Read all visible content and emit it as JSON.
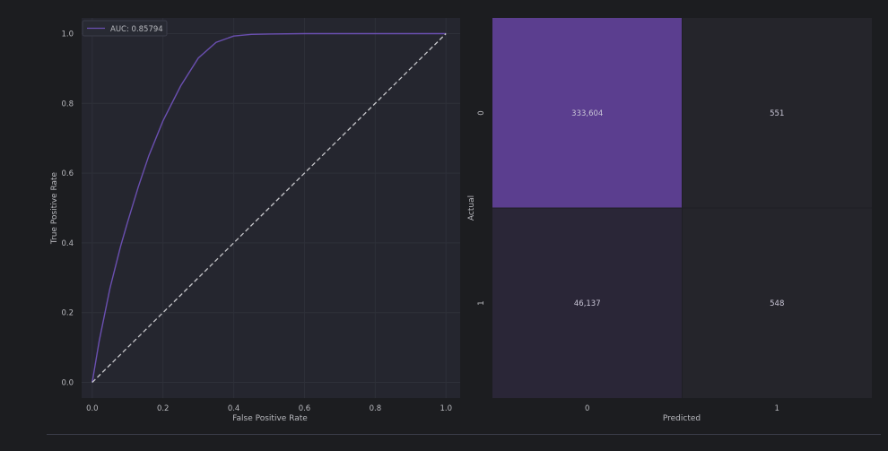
{
  "chart_data": [
    {
      "type": "line",
      "title": "",
      "xlabel": "False Positive Rate",
      "ylabel": "True Positive Rate",
      "xlim": [
        -0.03,
        1.04
      ],
      "ylim": [
        -0.045,
        1.045
      ],
      "xticks": [
        "0.0",
        "0.2",
        "0.4",
        "0.6",
        "0.8",
        "1.0"
      ],
      "yticks": [
        "0.0",
        "0.2",
        "0.4",
        "0.6",
        "0.8",
        "1.0"
      ],
      "grid": true,
      "legend": {
        "position": "top-left",
        "entries": [
          "AUC: 0.85794"
        ]
      },
      "series": [
        {
          "name": "AUC: 0.85794",
          "color": "#6a4fb0",
          "style": "solid",
          "x": [
            0.0,
            0.02,
            0.05,
            0.08,
            0.1,
            0.13,
            0.16,
            0.2,
            0.25,
            0.3,
            0.35,
            0.4,
            0.45,
            0.5,
            0.6,
            0.7,
            0.8,
            0.9,
            1.0
          ],
          "y": [
            0.0,
            0.12,
            0.27,
            0.39,
            0.46,
            0.56,
            0.65,
            0.75,
            0.85,
            0.93,
            0.975,
            0.993,
            0.998,
            0.999,
            1.0,
            1.0,
            1.0,
            1.0,
            1.0
          ]
        },
        {
          "name": "",
          "color": "#c8c8cc",
          "style": "dashed",
          "x": [
            0.0,
            1.0
          ],
          "y": [
            0.0,
            1.0
          ]
        }
      ]
    },
    {
      "type": "heatmap",
      "title": "",
      "xlabel": "Predicted",
      "ylabel": "Actual",
      "x_categories": [
        "0",
        "1"
      ],
      "y_categories": [
        "0",
        "1"
      ],
      "values": [
        [
          333604,
          551
        ],
        [
          46137,
          548
        ]
      ],
      "labels": [
        [
          "333,604",
          "551"
        ],
        [
          "46,137",
          "548"
        ]
      ],
      "colors": [
        [
          "#5b3e8f",
          "#25252b"
        ],
        [
          "#2a2637",
          "#25252b"
        ]
      ]
    }
  ]
}
